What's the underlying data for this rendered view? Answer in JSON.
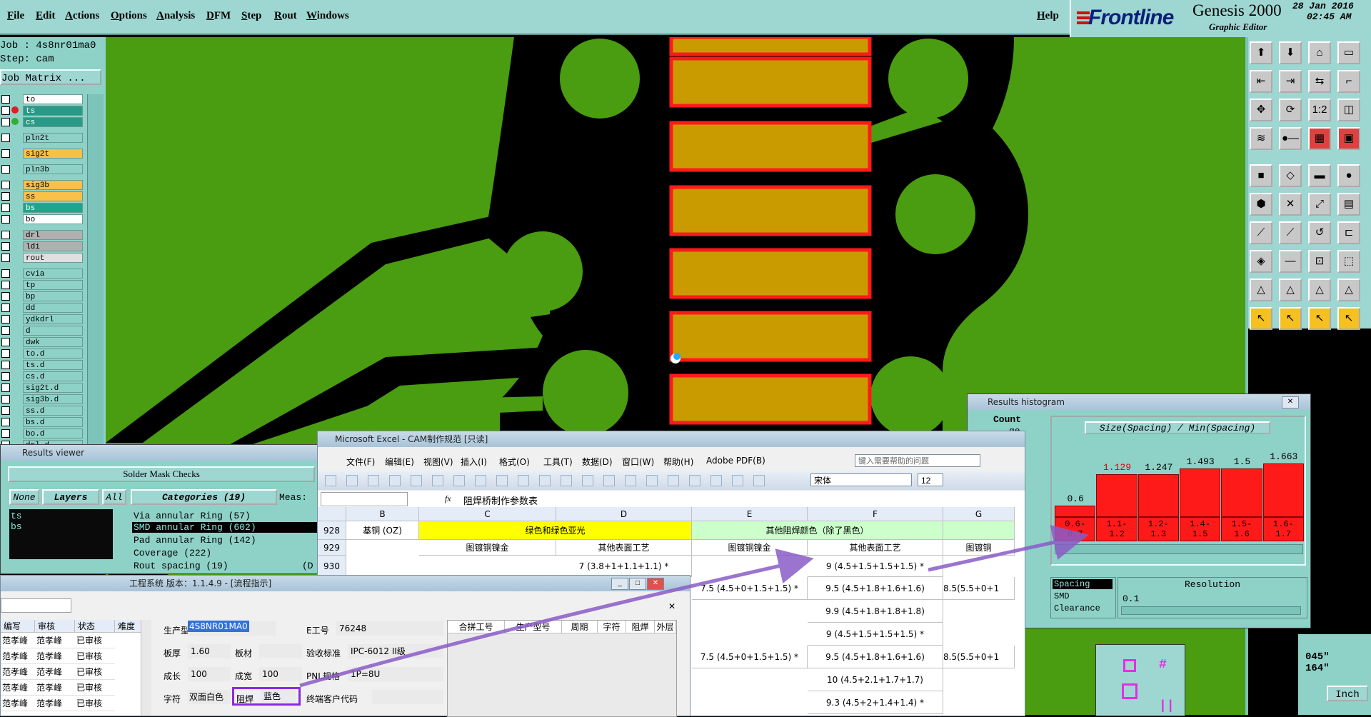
{
  "menu": [
    "File",
    "Edit",
    "Actions",
    "Options",
    "Analysis",
    "DFM",
    "Step",
    "Rout",
    "Windows"
  ],
  "help": "Help",
  "brand": {
    "logo": "Frontline",
    "product": "Genesis 2000",
    "subtitle": "Graphic Editor",
    "date": "28 Jan 2016",
    "time": "02:45 AM"
  },
  "job": {
    "job_line": "Job : 4s8nr01ma0",
    "step_line": "Step: cam",
    "matrix_label": "Job Matrix ..."
  },
  "layers": [
    "to",
    "ts",
    "cs",
    "pln2t",
    "sig2t",
    "pln3b",
    "sig3b",
    "ss",
    "bs",
    "bo",
    "drl",
    "ldi",
    "rout",
    "cvia",
    "tp",
    "bp",
    "dd",
    "ydkdrl",
    "d",
    "dwk",
    "to.d",
    "ts.d",
    "cs.d",
    "sig2t.d",
    "sig3b.d",
    "ss.d",
    "bs.d",
    "bo.d",
    "drl.d"
  ],
  "results_viewer": {
    "title": "Results viewer",
    "header": "Solder Mask Checks",
    "buttons": [
      "None",
      "Layers",
      "All"
    ],
    "categories_label": "Categories (19)",
    "meas_label": "Meas:",
    "layer_list": [
      "ts",
      "bs"
    ],
    "categories": [
      "Via annular Ring (57)",
      "SMD annular Ring (602)",
      "Pad annular Ring (142)",
      "Coverage (222)",
      "Rout spacing (19)"
    ],
    "marker": "(D"
  },
  "excel": {
    "title": "Microsoft Excel - CAM制作规范  [只读]",
    "menu": [
      "文件(F)",
      "编辑(E)",
      "视图(V)",
      "插入(I)",
      "格式(O)",
      "工具(T)",
      "数据(D)",
      "窗口(W)",
      "帮助(H)",
      "Adobe PDF(B)"
    ],
    "help_placeholder": "键入需要帮助的问题",
    "font": "宋体",
    "size": "12",
    "formula": "阻焊桥制作参数表",
    "fx": "fx",
    "cols": [
      "B",
      "C",
      "D",
      "E",
      "F",
      "G"
    ],
    "rows": [
      "928",
      "929",
      "930"
    ],
    "cells": {
      "b928": "基铜 (OZ)",
      "cd928": "绿色和绿色亚光",
      "ef928": "其他阻焊颜色（除了黑色）",
      "c929": "图镀铜镍金",
      "d929": "其他表面工艺",
      "e929": "图镀铜镍金",
      "f929": "其他表面工艺",
      "g929": "图镀铜",
      "d930": "7 (3.8+1+1.1+1.1) *",
      "f930": "9 (4.5+1.5+1.5+1.5) *",
      "e931": "7.5 (4.5+0+1.5+1.5) *",
      "f931": "9.5 (4.5+1.8+1.6+1.6)",
      "g931": "8.5(5.5+0+1",
      "f932": "9.9 (4.5+1.8+1.8+1.8)",
      "f933": "9 (4.5+1.5+1.5+1.5) *",
      "e934": "7.5 (4.5+0+1.5+1.5) *",
      "f934": "9.5 (4.5+1.8+1.6+1.6)",
      "g934": "8.5(5.5+0+1",
      "f935": "10 (4.5+2.1+1.7+1.7)",
      "f936": "9.3 (4.5+2+1.4+1.4) *"
    }
  },
  "histogram": {
    "title": "Results histogram",
    "count_label": "Count",
    "truncated": "ge",
    "chart_title": "Size(Spacing) / Min(Spacing)",
    "bar_labels": [
      "0.6",
      "1.129",
      "1.247",
      "1.493",
      "1.5",
      "1.663"
    ],
    "bins": [
      "0.6-\n0.7",
      "1.1-\n1.2",
      "1.2-\n1.3",
      "1.4-\n1.5",
      "1.5-\n1.6",
      "1.6-\n1.7"
    ],
    "bar_levels": [
      0.15,
      0.55,
      0.55,
      0.62,
      0.62,
      0.68
    ],
    "list": [
      "Spacing",
      "SMD",
      "Clearance"
    ],
    "resolution_label": "Resolution",
    "resolution_value": "0.1"
  },
  "project": {
    "title": "工程系统  版本：1.1.4.9 - [流程指示]",
    "left_headers": [
      "编写",
      "审核",
      "状态",
      "难度"
    ],
    "left_rows": [
      [
        "范孝峰",
        "范孝峰",
        "已审核"
      ],
      [
        "范孝峰",
        "范孝峰",
        "已审核"
      ],
      [
        "范孝峰",
        "范孝峰",
        "已审核"
      ],
      [
        "范孝峰",
        "范孝峰",
        "已审核"
      ],
      [
        "范孝峰",
        "范孝峰",
        "已审核"
      ]
    ],
    "fields": {
      "prod_model_label": "生产型号",
      "prod_model": "4S8NR01MA0",
      "e_no_label": "E工号",
      "e_no": "76248",
      "thickness_label": "板厚",
      "thickness": "1.60",
      "material_label": "板材",
      "material": "",
      "accept_label": "验收标准",
      "accept": "IPC-6012 II级",
      "length_label": "成长",
      "length": "100",
      "width_label": "成宽",
      "width": "100",
      "pnl_label": "PNL规格",
      "pnl": "1P=8U",
      "char_label": "字符",
      "char": "双面白色",
      "mask_label": "阻焊",
      "mask": "蓝色",
      "customer_label": "终端客户代码",
      "customer": ""
    },
    "right_headers": [
      "合拼工号",
      "生产型号",
      "周期",
      "字符",
      "阻焊",
      "外层"
    ]
  },
  "coords": {
    "line1": "045\"",
    "line2": "164\""
  },
  "unit": "Inch",
  "colors": {
    "pcb_green": "#4a9c10",
    "copper": "#c99b00",
    "mask_red": "#ff1a1a",
    "cyan_bg": "#9ed6d2",
    "arrow": "#8a5cc8"
  }
}
